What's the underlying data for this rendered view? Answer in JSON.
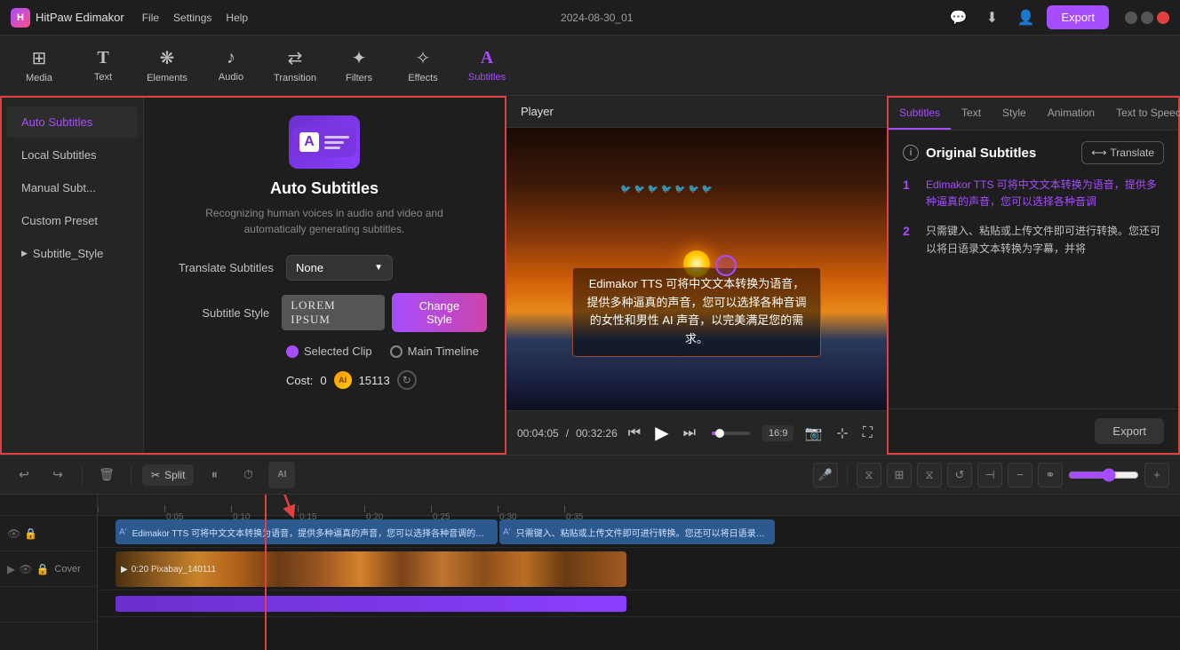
{
  "app": {
    "name": "HitPaw Edimakor",
    "file_menu": "File",
    "settings_menu": "Settings",
    "help_menu": "Help",
    "title": "2024-08-30_01",
    "export_button": "Export"
  },
  "toolbar": {
    "items": [
      {
        "id": "media",
        "label": "Media",
        "icon": "⊞"
      },
      {
        "id": "text",
        "label": "Text",
        "icon": "T"
      },
      {
        "id": "elements",
        "label": "Elements",
        "icon": "❋"
      },
      {
        "id": "audio",
        "label": "Audio",
        "icon": "♩"
      },
      {
        "id": "transition",
        "label": "Transition",
        "icon": "⇄"
      },
      {
        "id": "filters",
        "label": "Filters",
        "icon": "✦"
      },
      {
        "id": "effects",
        "label": "Effects",
        "icon": "✧"
      },
      {
        "id": "subtitles",
        "label": "Subtitles",
        "icon": "A"
      }
    ],
    "active": "subtitles"
  },
  "left_panel": {
    "sidebar_items": [
      {
        "id": "auto-subtitles",
        "label": "Auto Subtitles",
        "active": true
      },
      {
        "id": "local-subtitles",
        "label": "Local Subtitles"
      },
      {
        "id": "manual-subtitles",
        "label": "Manual Subt..."
      },
      {
        "id": "custom-preset",
        "label": "Custom Preset"
      },
      {
        "id": "subtitle-style",
        "label": "Subtitle_Style",
        "arrow": true
      }
    ],
    "content": {
      "title": "Auto Subtitles",
      "description": "Recognizing human voices in audio and video and automatically generating subtitles.",
      "translate_label": "Translate Subtitles",
      "translate_value": "None",
      "style_label": "Subtitle Style",
      "style_preview": "LOREM IPSUM",
      "change_style_btn": "Change Style",
      "radio_selected": "Selected Clip",
      "radio_option2": "Main Timeline",
      "cost_label": "Cost:",
      "cost_value": "0",
      "coin_count": "15113"
    }
  },
  "player": {
    "header_title": "Player",
    "current_time": "00:04:05",
    "total_time": "00:32:26",
    "aspect_ratio": "16:9",
    "subtitle_text": "Edimakor TTS 可将中文文本转换为语音，\n提供多种逼真的声音，您可以选择各种音调的女性和男性\nAI 声音，以完美满足您的需求。"
  },
  "right_panel": {
    "tabs": [
      "Subtitles",
      "Text",
      "Style",
      "Animation",
      "Text to Speech"
    ],
    "active_tab": "Subtitles",
    "section_title": "Original Subtitles",
    "translate_btn": "Translate",
    "entries": [
      {
        "num": "1",
        "text": "Edimakor TTS 可将中文文本转换为语音，提供多种逼真的声音，您可以选择各种音调",
        "colored": true
      },
      {
        "num": "2",
        "text": "只需键入、粘贴或上传文件即可进行转换。您还可以将日语录文本转换为字幕，并将",
        "colored": false
      }
    ],
    "export_btn": "Export"
  },
  "timeline": {
    "undo_tooltip": "Undo",
    "redo_tooltip": "Redo",
    "delete_tooltip": "Delete",
    "split_label": "Split",
    "time_marks": [
      "0:05",
      "0:10",
      "0:15",
      "0:20",
      "0:25",
      "0:30",
      "0:35"
    ],
    "subtitle_clip1_text": "Edimakor TTS 可将中文文本转换为语音，提供多种逼真的声音，您可以选择各种音调的女性和男",
    "subtitle_clip2_text": "只需键入、粘贴或上传文件即可进行转换。您还可以将日语录文本转换为",
    "video_clip_label": "0:20 Pixabay_140111",
    "cover_label": "Cover"
  }
}
